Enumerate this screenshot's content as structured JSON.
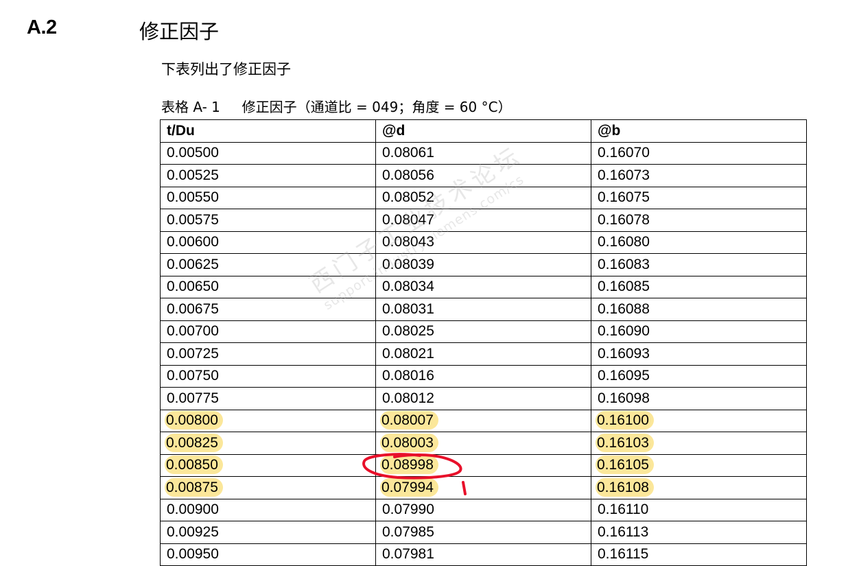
{
  "section": {
    "number": "A.2",
    "title": "修正因子"
  },
  "intro_text": "下表列出了修正因子",
  "caption": "表格 A- 1     修正因子（通道比 = 049；角度 = 60 °C）",
  "table": {
    "headers": [
      "t/Du",
      "@d",
      "@b"
    ],
    "rows": [
      [
        "0.00500",
        "0.08061",
        "0.16070"
      ],
      [
        "0.00525",
        "0.08056",
        "0.16073"
      ],
      [
        "0.00550",
        "0.08052",
        "0.16075"
      ],
      [
        "0.00575",
        "0.08047",
        "0.16078"
      ],
      [
        "0.00600",
        "0.08043",
        "0.16080"
      ],
      [
        "0.00625",
        "0.08039",
        "0.16083"
      ],
      [
        "0.00650",
        "0.08034",
        "0.16085"
      ],
      [
        "0.00675",
        "0.08031",
        "0.16088"
      ],
      [
        "0.00700",
        "0.08025",
        "0.16090"
      ],
      [
        "0.00725",
        "0.08021",
        "0.16093"
      ],
      [
        "0.00750",
        "0.08016",
        "0.16095"
      ],
      [
        "0.00775",
        "0.08012",
        "0.16098"
      ],
      [
        "0.00800",
        "0.08007",
        "0.16100"
      ],
      [
        "0.00825",
        "0.08003",
        "0.16103"
      ],
      [
        "0.00850",
        "0.08998",
        "0.16105"
      ],
      [
        "0.00875",
        "0.07994",
        "0.16108"
      ],
      [
        "0.00900",
        "0.07990",
        "0.16110"
      ],
      [
        "0.00925",
        "0.07985",
        "0.16113"
      ],
      [
        "0.00950",
        "0.07981",
        "0.16115"
      ]
    ],
    "highlighted_rows": [
      12,
      13,
      14,
      15
    ],
    "circled_cell": {
      "row": 14,
      "col": 1
    }
  },
  "watermark": {
    "line1": "西门子工业技术论坛",
    "line2": "support.industry.siemens.com/cs"
  },
  "colors": {
    "highlight": "#fbe79a",
    "annotation": "#e8102a"
  }
}
